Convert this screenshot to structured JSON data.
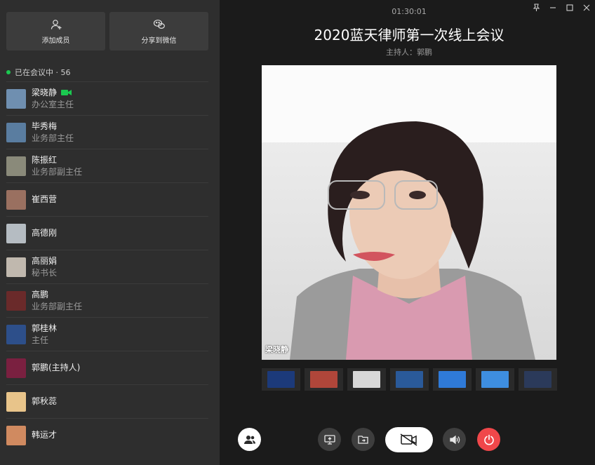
{
  "sidebar": {
    "add_member_label": "添加成员",
    "share_wechat_label": "分享到微信",
    "status_text": "已在会议中 · 56",
    "members": [
      {
        "name": "梁晓静",
        "title": "办公室主任",
        "camera_on": true,
        "avatar_color": "#6f8fb0"
      },
      {
        "name": "毕秀梅",
        "title": "业务部主任",
        "camera_on": false,
        "avatar_color": "#5a7da0"
      },
      {
        "name": "陈振红",
        "title": "业务部副主任",
        "camera_on": false,
        "avatar_color": "#8a8a7a"
      },
      {
        "name": "崔西营",
        "title": "",
        "camera_on": false,
        "avatar_color": "#9a7060"
      },
      {
        "name": "高德刚",
        "title": "",
        "camera_on": false,
        "avatar_color": "#b5bcc2"
      },
      {
        "name": "高丽娟",
        "title": "秘书长",
        "camera_on": false,
        "avatar_color": "#c0b8ae"
      },
      {
        "name": "高鹏",
        "title": "业务部副主任",
        "camera_on": false,
        "avatar_color": "#6a2a2a"
      },
      {
        "name": "郭桂林",
        "title": "主任",
        "camera_on": false,
        "avatar_color": "#2d4f8a"
      },
      {
        "name": "郭鹏(主持人)",
        "title": "",
        "camera_on": false,
        "avatar_color": "#7a2040"
      },
      {
        "name": "郭秋蕊",
        "title": "",
        "camera_on": false,
        "avatar_color": "#e8c48a"
      },
      {
        "name": "韩运才",
        "title": "",
        "camera_on": false,
        "avatar_color": "#d08a60"
      }
    ]
  },
  "header": {
    "timer": "01:30:01",
    "title": "2020蓝天律师第一次线上会议",
    "host": "主持人：郭鹏"
  },
  "video": {
    "speaker_label": "梁晓静"
  },
  "thumbnails": [
    {
      "color": "#1c3a7a"
    },
    {
      "color": "#b0463a"
    },
    {
      "color": "#d8d8d8"
    },
    {
      "color": "#2a5a9a"
    },
    {
      "color": "#2f7ad8"
    },
    {
      "color": "#3e8ee0"
    },
    {
      "color": "#2b3a5a"
    }
  ],
  "colors": {
    "accent_green": "#1bc950",
    "end_call_red": "#f0474a"
  },
  "icons": {
    "add_member": "add-user-icon",
    "share_wechat": "wechat-icon",
    "members": "members-icon",
    "screen_share": "screen-share-icon",
    "file_share": "file-share-icon",
    "camera": "camera-off-icon",
    "speaker": "speaker-icon",
    "end": "power-icon"
  }
}
